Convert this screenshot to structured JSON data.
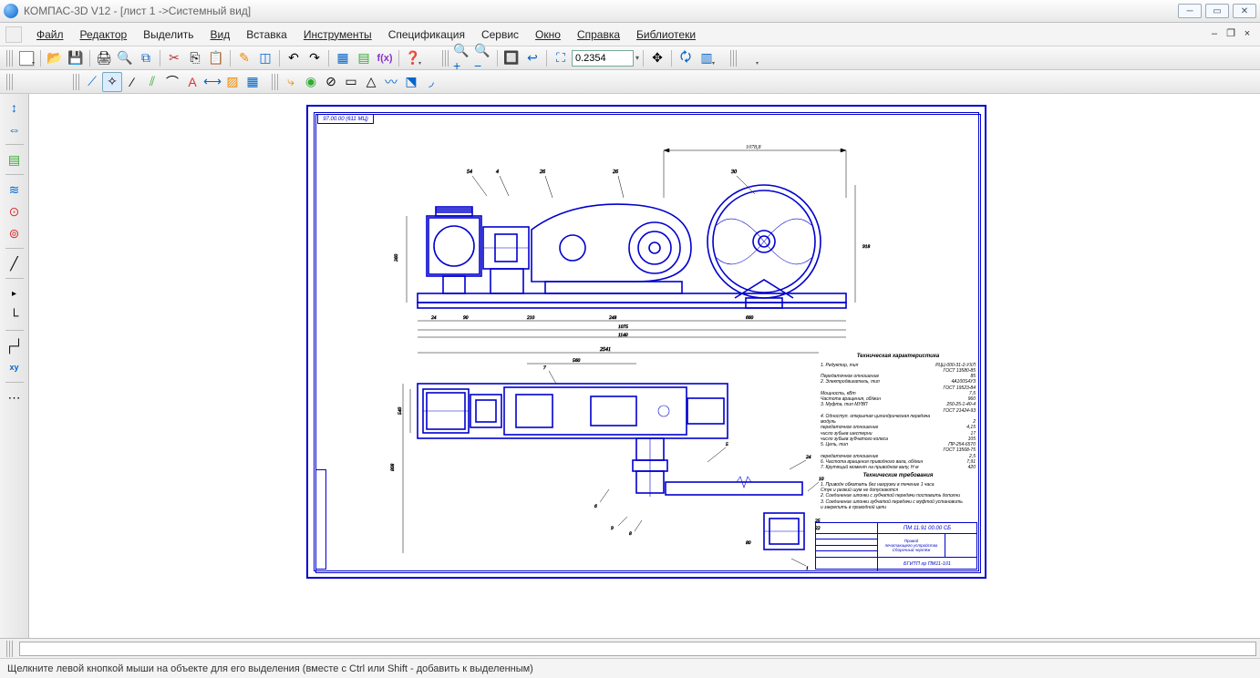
{
  "title": "КОМПАС-3D V12 - [лист 1 ->Системный вид]",
  "menus": [
    "Файл",
    "Редактор",
    "Выделить",
    "Вид",
    "Вставка",
    "Инструменты",
    "Спецификация",
    "Сервис",
    "Окно",
    "Справка",
    "Библиотеки"
  ],
  "zoom_value": "0.2354",
  "status": "Щелкните левой кнопкой мыши на объекте для его выделения (вместе с Ctrl или Shift - добавить к выделенным)",
  "sheet_label": "97.00.00 (611 МЦ)",
  "tech": {
    "heading1": "Техническая характеристика",
    "rows1": [
      [
        "1. Редуктор, тип",
        "РЦЦ-000-31-2-УХЛ"
      ],
      [
        "",
        "ГОСТ 13580-85"
      ],
      [
        "Передаточное отношение",
        "85"
      ],
      [
        "2. Электродвигатель, тип",
        "4А100S4У3"
      ],
      [
        "",
        "ГОСТ 19523-84"
      ],
      [
        "Мощность, кВт",
        "7,5"
      ],
      [
        "Частота вращения, об/мин",
        "960"
      ],
      [
        "3. Муфта, тип  МУВП",
        "250-25-1-40-4"
      ],
      [
        "",
        "ГОСТ 21424-93"
      ],
      [
        "4. Одноступ. открытая цилиндрическая передача",
        ""
      ],
      [
        "модуль",
        "2"
      ],
      [
        "передаточное отношение",
        "4,15"
      ],
      [
        "число зубьев шестерни",
        "17"
      ],
      [
        "число зубьев зубчатого колеса",
        "105"
      ],
      [
        "5. Цепь, тип",
        "ПР-254-6570"
      ],
      [
        "",
        "ГОСТ 13568-75"
      ],
      [
        "передаточное отношение",
        "2,5"
      ],
      [
        "6. Частота вращения приводного вала, об/мин",
        "7,91"
      ],
      [
        "7. Крутящий момент на приводном валу, Н·м",
        "420"
      ]
    ],
    "heading2": "Технические требования",
    "rows2": [
      "1. Приводн обкатать без нагрузки в течение    1 часа",
      "   Стук и резкий шум не допускаются",
      "2. Соединение шпонки с зубчатой передачи поставить дополни",
      "3. Соединение шпонки зубчатой передачи с муфтой установить",
      "   и закрепить в приводной цепи"
    ]
  },
  "title_block": {
    "code": "ПМ 11.91 00.00 СБ",
    "name": "Привод\\nпечатающего устройства\\nСпецификация чертежа",
    "org": "БГИТП гр ПМ11-101"
  },
  "dims_upper": {
    "top": "1078,8",
    "h_left": "360",
    "h_far": "918",
    "w1": "24",
    "w2": "90",
    "w3": "210",
    "w4": "248",
    "w5": "660",
    "total_bot": "1075",
    "total_bot2": "1140",
    "leaders": [
      "54",
      "4",
      "26",
      "26",
      "30"
    ]
  },
  "dims_lower": {
    "top": "2541",
    "seg": "560",
    "h_left": "808",
    "h_far": "540",
    "leaders": [
      "7",
      "5",
      "6",
      "24",
      "10",
      "1",
      "80",
      "25",
      "22",
      "9",
      "8"
    ]
  }
}
